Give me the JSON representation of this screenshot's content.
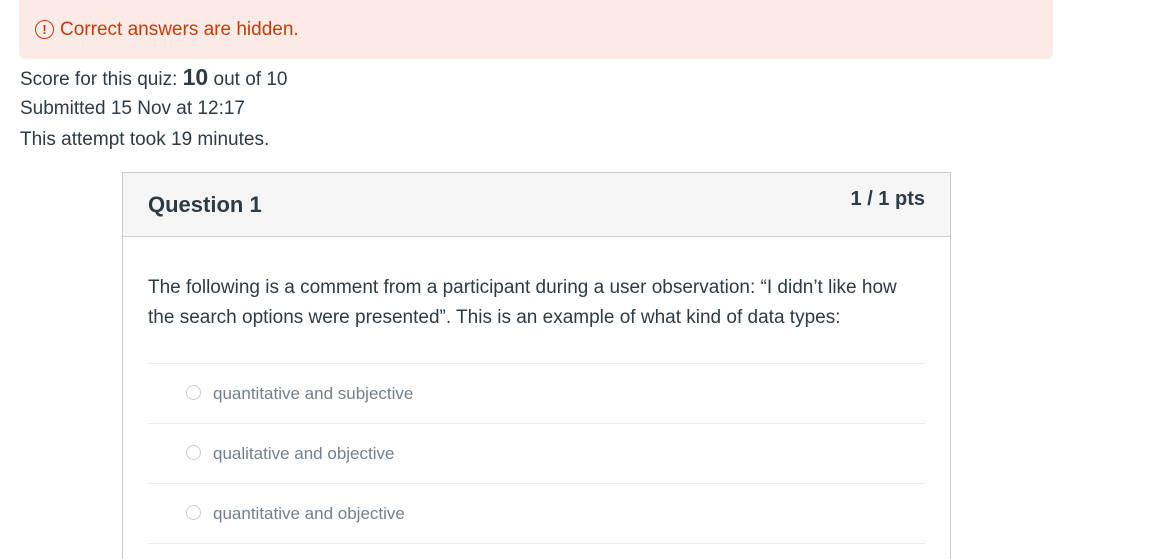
{
  "alert": {
    "icon": "exclamation-circle-icon",
    "icon_glyph": "!",
    "text": "Correct answers are hidden.",
    "color": "#c23c0d",
    "background": "#fbeae5"
  },
  "summary": {
    "score_prefix": "Score for this quiz: ",
    "score_value": "10",
    "score_suffix": " out of 10",
    "submitted": "Submitted 15 Nov at 12:17",
    "duration": "This attempt took 19 minutes."
  },
  "question": {
    "title": "Question 1",
    "points": "1 / 1 pts",
    "text": "The following is a comment from a participant during a user observation: “I didn’t like how the search options were presented”. This is an example of what kind of data types:",
    "answers": [
      {
        "label": "quantitative and subjective"
      },
      {
        "label": "qualitative and objective"
      },
      {
        "label": "quantitative and objective"
      }
    ]
  }
}
